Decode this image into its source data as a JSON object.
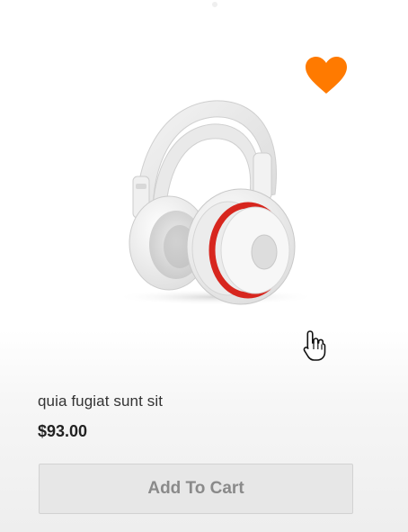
{
  "product": {
    "name": "quia fugiat sunt sit",
    "price": "$93.00",
    "image_icon": "headphones-product-image",
    "wishlist_icon": "heart-icon",
    "wishlist_color": "#ff7a00"
  },
  "actions": {
    "add_to_cart_label": "Add To Cart"
  },
  "cursor": {
    "icon": "hand-pointer-cursor"
  }
}
